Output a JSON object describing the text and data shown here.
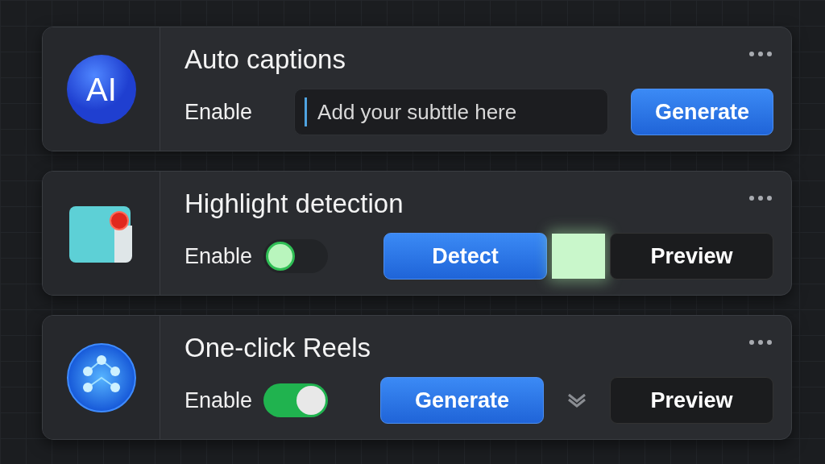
{
  "cards": [
    {
      "kind": "field",
      "icon_text": "AI",
      "title": "Auto captions",
      "enable_label": "Enable",
      "placeholder": "Add your subttle here",
      "actions": [
        "Generate"
      ]
    },
    {
      "kind": "swatch",
      "title": "Highlight detection",
      "enable_label": "Enable",
      "on": false,
      "actions": [
        "Detect",
        "Preview"
      ]
    },
    {
      "kind": "chevron",
      "title": "One-click Reels",
      "enable_label": "Enable",
      "on": true,
      "actions": [
        "Generate",
        "Preview"
      ]
    }
  ]
}
